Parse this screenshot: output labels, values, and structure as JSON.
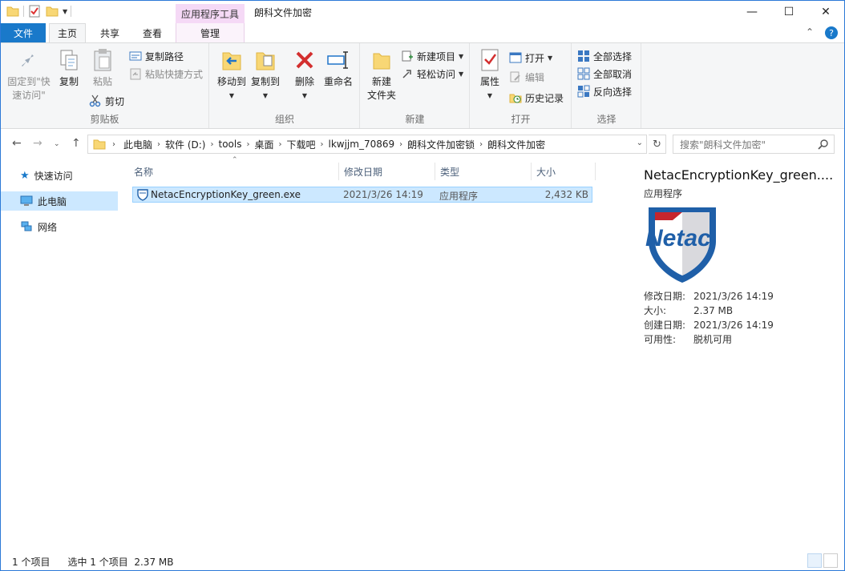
{
  "window": {
    "title": "朗科文件加密",
    "context_tab_header": "应用程序工具"
  },
  "tabs": {
    "file": "文件",
    "home": "主页",
    "share": "共享",
    "view": "查看",
    "manage": "管理"
  },
  "ribbon": {
    "clipboard": {
      "label": "剪贴板",
      "pin": "固定到\"快\n速访问\"",
      "copy": "复制",
      "paste": "粘贴",
      "cut": "剪切",
      "copy_path": "复制路径",
      "paste_shortcut": "粘贴快捷方式"
    },
    "organize": {
      "label": "组织",
      "move_to": "移动到",
      "copy_to": "复制到",
      "delete": "删除",
      "rename": "重命名"
    },
    "new": {
      "label": "新建",
      "new_folder": "新建\n文件夹",
      "new_item": "新建项目",
      "easy_access": "轻松访问"
    },
    "open": {
      "label": "打开",
      "properties": "属性",
      "open": "打开",
      "edit": "编辑",
      "history": "历史记录"
    },
    "select": {
      "label": "选择",
      "select_all": "全部选择",
      "select_none": "全部取消",
      "invert": "反向选择"
    }
  },
  "address": {
    "crumbs": [
      "此电脑",
      "软件 (D:)",
      "tools",
      "桌面",
      "下载吧",
      "lkwjjm_70869",
      "朗科文件加密锁",
      "朗科文件加密"
    ],
    "search_placeholder": "搜索\"朗科文件加密\""
  },
  "nav": {
    "items": [
      {
        "label": "快速访问",
        "icon": "star-icon"
      },
      {
        "label": "此电脑",
        "icon": "computer-icon"
      },
      {
        "label": "网络",
        "icon": "network-icon"
      }
    ]
  },
  "columns": {
    "name": "名称",
    "modified": "修改日期",
    "type": "类型",
    "size": "大小"
  },
  "files": [
    {
      "name": "NetacEncryptionKey_green.exe",
      "modified": "2021/3/26 14:19",
      "type": "应用程序",
      "size": "2,432 KB"
    }
  ],
  "preview": {
    "title": "NetacEncryptionKey_green....",
    "type": "应用程序",
    "logo_text": "Netac",
    "props": [
      {
        "k": "修改日期:",
        "v": "2021/3/26 14:19"
      },
      {
        "k": "大小:",
        "v": "2.37 MB"
      },
      {
        "k": "创建日期:",
        "v": "2021/3/26 14:19"
      },
      {
        "k": "可用性:",
        "v": "脱机可用"
      }
    ]
  },
  "status": {
    "count": "1 个项目",
    "selected": "选中 1 个项目",
    "size": "2.37 MB"
  },
  "colors": {
    "accent": "#1979ca",
    "selection": "#cce8ff",
    "context_tab": "#f5d9f6"
  }
}
